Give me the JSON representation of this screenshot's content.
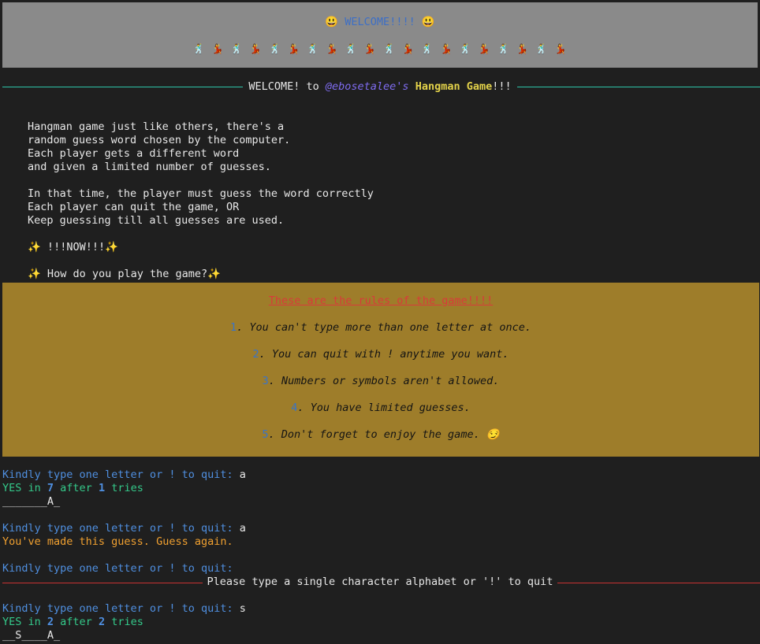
{
  "banner": {
    "title": "😃 WELCOME!!!! 😃",
    "dancers": "🕺 💃 🕺 💃 🕺 💃 🕺 💃 🕺 💃 🕺 💃 🕺 💃 🕺 💃 🕺 💃 🕺 💃",
    "background": "#8a8a8a"
  },
  "welcome": {
    "prefix": "WELCOME! to ",
    "handle": "@ebosetalee's",
    "space": " ",
    "game_name": "Hangman Game",
    "suffix": "!!!",
    "rule_color": "#2ec4a8"
  },
  "intro": {
    "lines": [
      "Hangman game just like others, there's a",
      "random guess word chosen by the computer.",
      "Each player gets a different word",
      "and given a limited number of guesses.",
      "",
      "In that time, the player must guess the word correctly",
      "Each player can quit the game, OR",
      "Keep guessing till all guesses are used.",
      "",
      "✨ !!!NOW!!!✨",
      "",
      "✨ How do you play the game?✨"
    ]
  },
  "rules": {
    "title": "These are the rules of the game!!!!",
    "background": "#9e7d2a",
    "items": [
      {
        "num": "1",
        "text": ". You can't type more than one letter at once."
      },
      {
        "num": "2",
        "text": ". You can quit with ! anytime you want."
      },
      {
        "num": "3",
        "text": ". Numbers or symbols aren't allowed."
      },
      {
        "num": "4",
        "text": ". You have limited guesses."
      },
      {
        "num": "5",
        "text": ". Don't forget to enjoy the game. 😏"
      }
    ]
  },
  "session": {
    "prompt": "Kindly type one letter or ! to quit:",
    "turn1": {
      "input": " a",
      "yes": "YES in ",
      "guesses_left": "7",
      "after": " after ",
      "tries": "1",
      "tries_label": " tries",
      "word": "_______A_"
    },
    "turn2": {
      "input": " a",
      "message": "You've made this guess. Guess again."
    },
    "turn3": {
      "input": ""
    },
    "error": "Please type a single character alphabet or '!' to quit",
    "error_rule_color": "#c83232",
    "turn4": {
      "input": " s",
      "yes": "YES in ",
      "guesses_left": "2",
      "after": " after ",
      "tries": "2",
      "tries_label": " tries",
      "word": "__S____A_"
    }
  }
}
